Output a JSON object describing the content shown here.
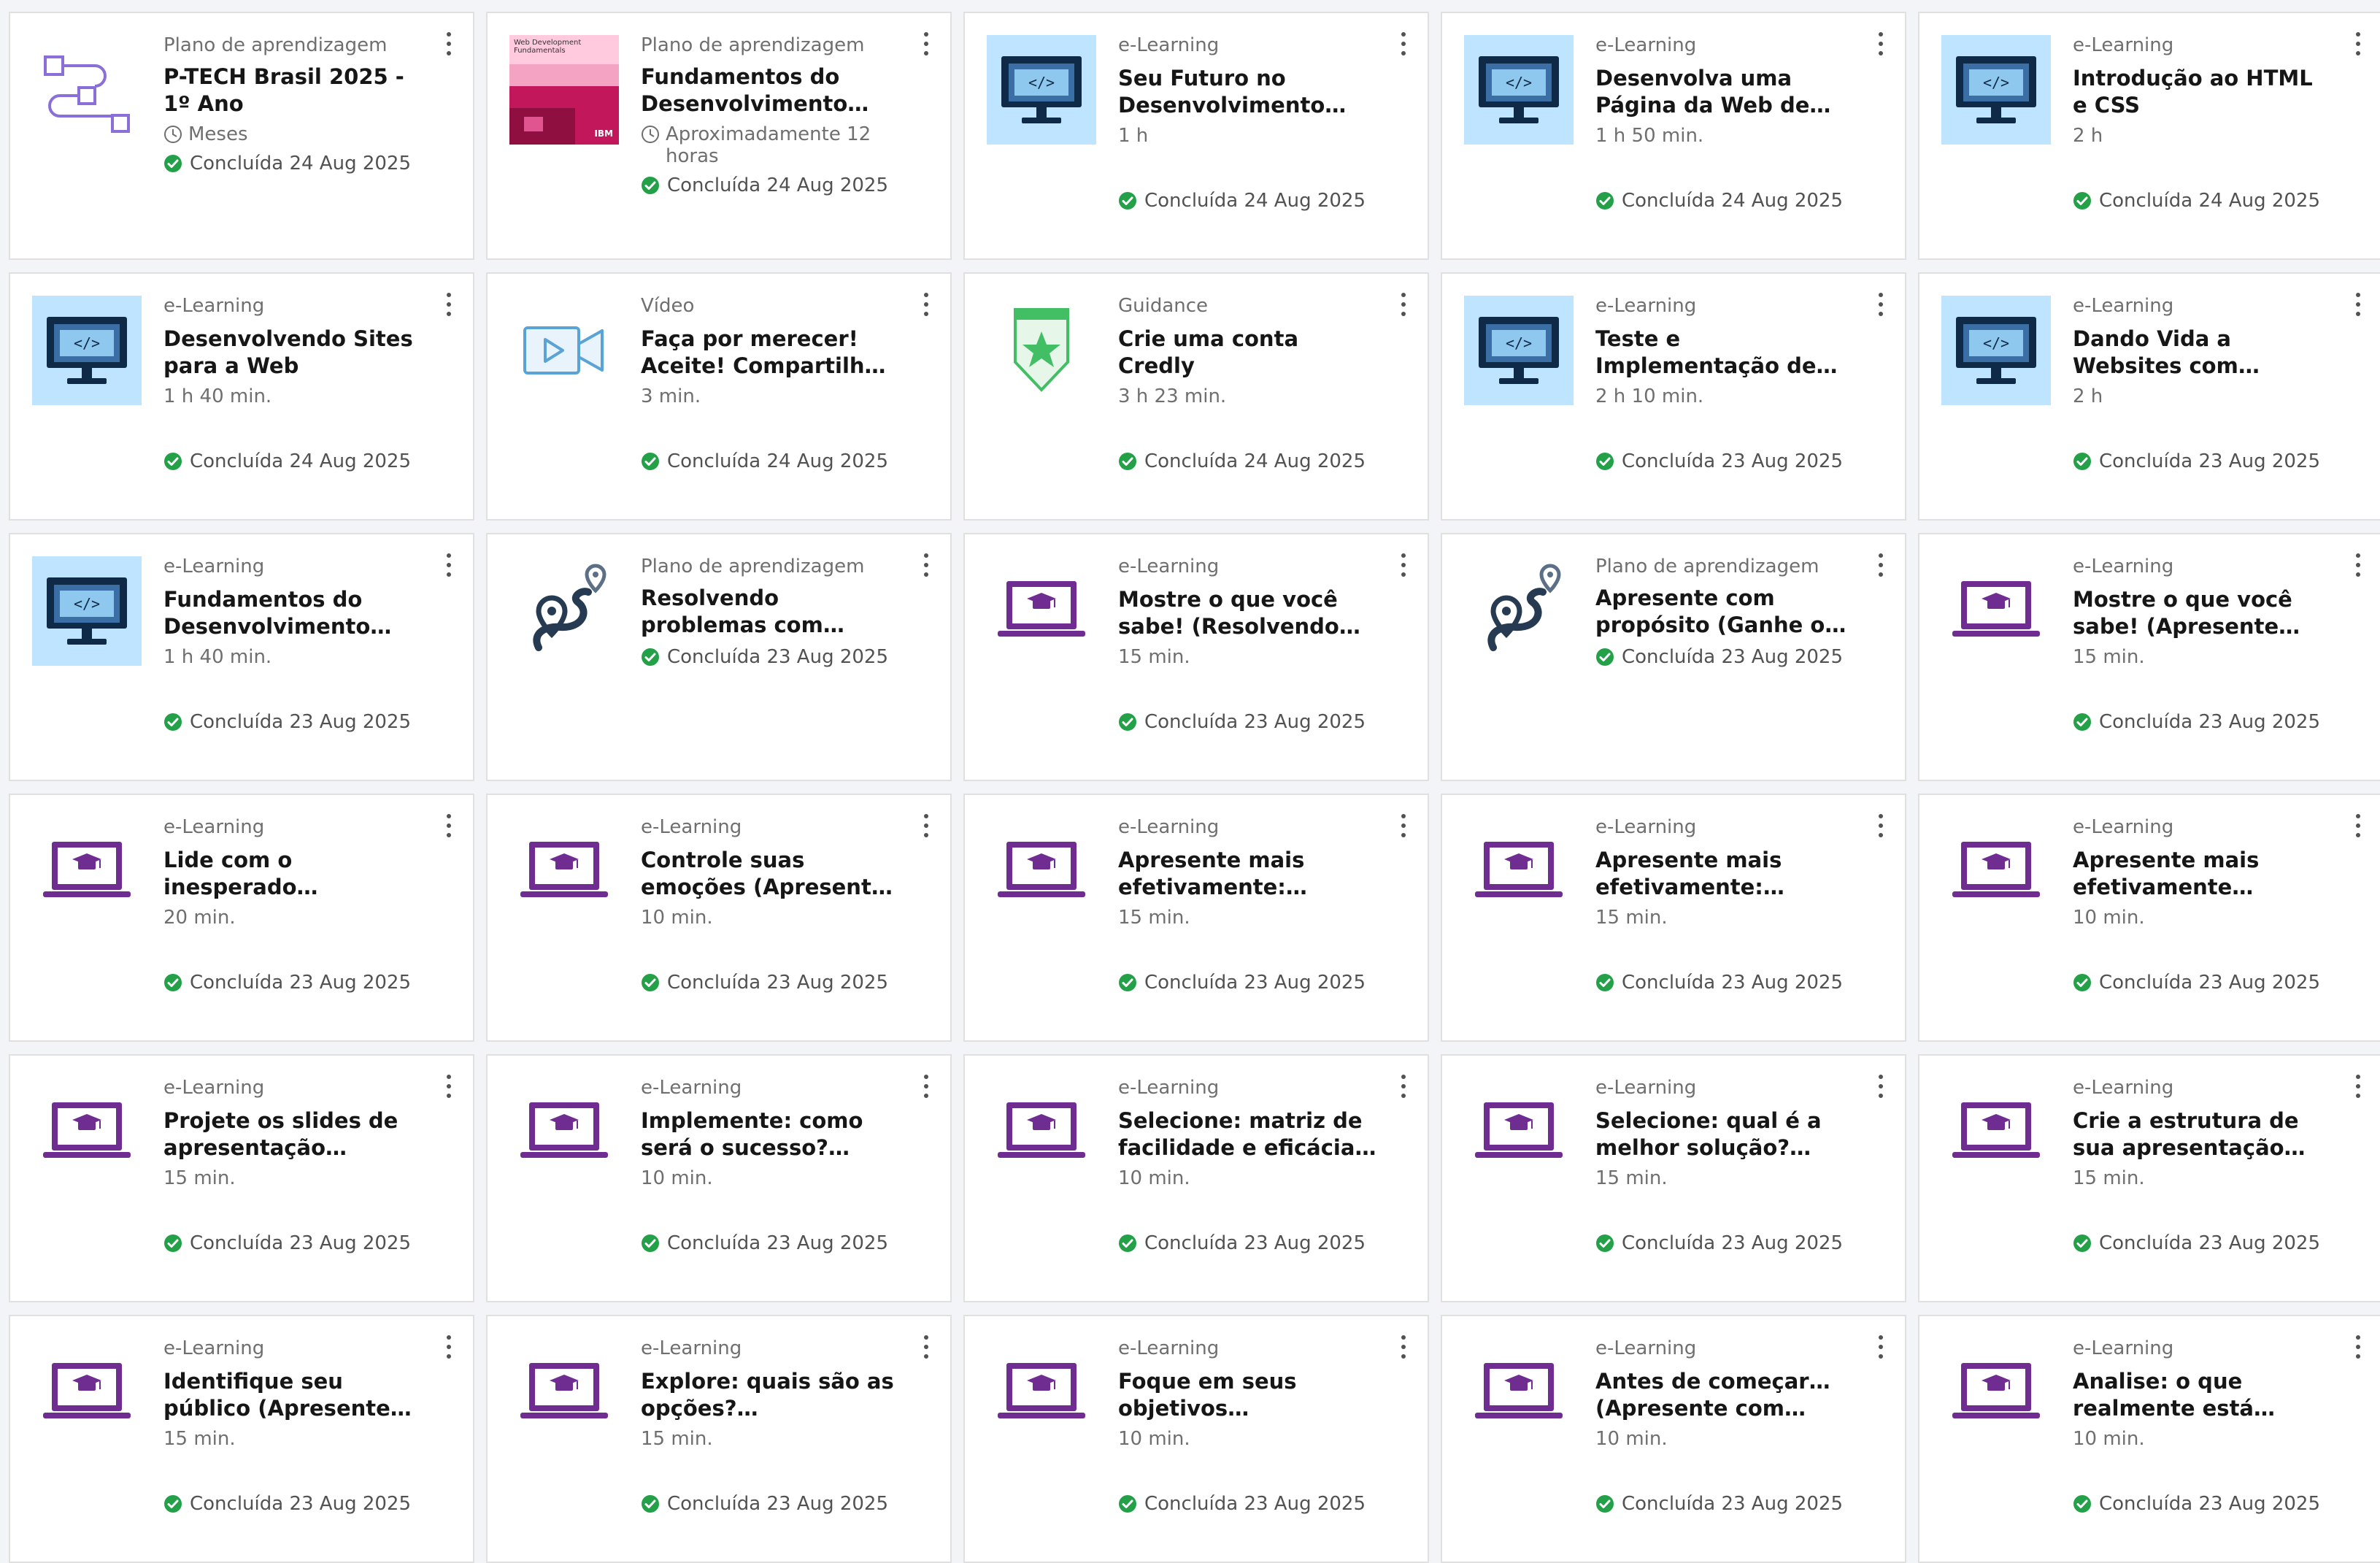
{
  "colors": {
    "accent_purple": "#6f2d91",
    "thumb_bg": "#bfe4ff",
    "monitor_dark": "#0e2a47",
    "success_green": "#24a148",
    "path_dark": "#263a52",
    "lavender": "#8a6fd8",
    "video_blue": "#5aa3d6",
    "badge_green": "#42be65"
  },
  "cards": [
    {
      "type": "Plano de aprendizagem",
      "title": "P-TECH Brasil 2025 - 1º Ano",
      "duration": "Meses",
      "status": "Concluída 24 Aug 2025",
      "icon": "learning-plan-icon",
      "clock": true
    },
    {
      "type": "Plano de aprendizagem",
      "title": "Fundamentos do Desenvolvimento Web…",
      "duration": "Aproximadamente 12 horas",
      "status": "Concluída 24 Aug 2025",
      "icon": "book-cover",
      "clock": true,
      "cover_title": "Web Development Fundamentals",
      "cover_brand": "IBM"
    },
    {
      "type": "e-Learning",
      "title": "Seu Futuro no Desenvolvimento Web…",
      "duration": "1 h",
      "status": "Concluída 24 Aug 2025",
      "icon": "monitor-code-icon"
    },
    {
      "type": "e-Learning",
      "title": "Desenvolva uma Página da Web de Lista de…",
      "duration": "1 h 50 min.",
      "status": "Concluída 24 Aug 2025",
      "icon": "monitor-code-icon"
    },
    {
      "type": "e-Learning",
      "title": "Introdução ao HTML e CSS",
      "duration": "2 h",
      "status": "Concluída 24 Aug 2025",
      "icon": "monitor-code-icon"
    },
    {
      "type": "e-Learning",
      "title": "Desenvolvendo Sites para a Web",
      "duration": "1 h 40 min.",
      "status": "Concluída 24 Aug 2025",
      "icon": "monitor-code-icon"
    },
    {
      "type": "Vídeo",
      "title": "Faça por merecer! Aceite! Compartilhe! |…",
      "duration": "3 min.",
      "status": "Concluída 24 Aug 2025",
      "icon": "video-icon"
    },
    {
      "type": "Guidance",
      "title": "Crie uma conta Credly",
      "duration": "3 h 23 min.",
      "status": "Concluída 24 Aug 2025",
      "icon": "badge-star-icon"
    },
    {
      "type": "e-Learning",
      "title": "Teste e Implementação de Website",
      "duration": "2 h 10 min.",
      "status": "Concluída 23 Aug 2025",
      "icon": "monitor-code-icon"
    },
    {
      "type": "e-Learning",
      "title": "Dando Vida a Websites com JavaScript",
      "duration": "2 h",
      "status": "Concluída 23 Aug 2025",
      "icon": "monitor-code-icon"
    },
    {
      "type": "e-Learning",
      "title": "Fundamentos do Desenvolvimento Web",
      "duration": "1 h 40 min.",
      "status": "Concluída 23 Aug 2025",
      "icon": "monitor-code-icon"
    },
    {
      "type": "Plano de aprendizagem",
      "title": "Resolvendo problemas com pensamento críti…",
      "duration": "",
      "status": "Concluída 23 Aug 2025",
      "icon": "map-path-icon"
    },
    {
      "type": "e-Learning",
      "title": "Mostre o que você sabe! (Resolvendo problem…",
      "duration": "15 min.",
      "status": "Concluída 23 Aug 2025",
      "icon": "laptop-graduation-icon"
    },
    {
      "type": "Plano de aprendizagem",
      "title": "Apresente com propósito (Ganhe o…",
      "duration": "",
      "status": "Concluída 23 Aug 2025",
      "icon": "map-path-icon"
    },
    {
      "type": "e-Learning",
      "title": "Mostre o que você sabe! (Apresente com…",
      "duration": "15 min.",
      "status": "Concluída 23 Aug 2025",
      "icon": "laptop-graduation-icon"
    },
    {
      "type": "e-Learning",
      "title": "Lide com o inesperado (Apresente com…",
      "duration": "20 min.",
      "status": "Concluída 23 Aug 2025",
      "icon": "laptop-graduation-icon"
    },
    {
      "type": "e-Learning",
      "title": "Controle suas emoções (Apresente com…",
      "duration": "10 min.",
      "status": "Concluída 23 Aug 2025",
      "icon": "laptop-graduation-icon"
    },
    {
      "type": "e-Learning",
      "title": "Apresente mais efetivamente: Técnica…",
      "duration": "15 min.",
      "status": "Concluída 23 Aug 2025",
      "icon": "laptop-graduation-icon"
    },
    {
      "type": "e-Learning",
      "title": "Apresente mais efetivamente: Técnica…",
      "duration": "15 min.",
      "status": "Concluída 23 Aug 2025",
      "icon": "laptop-graduation-icon"
    },
    {
      "type": "e-Learning",
      "title": "Apresente mais efetivamente…",
      "duration": "10 min.",
      "status": "Concluída 23 Aug 2025",
      "icon": "laptop-graduation-icon"
    },
    {
      "type": "e-Learning",
      "title": "Projete os slides de apresentação…",
      "duration": "15 min.",
      "status": "Concluída 23 Aug 2025",
      "icon": "laptop-graduation-icon"
    },
    {
      "type": "e-Learning",
      "title": "Implemente: como será o sucesso? (Resolven…",
      "duration": "10 min.",
      "status": "Concluída 23 Aug 2025",
      "icon": "laptop-graduation-icon"
    },
    {
      "type": "e-Learning",
      "title": "Selecione: matriz de facilidade e eficácia…",
      "duration": "10 min.",
      "status": "Concluída 23 Aug 2025",
      "icon": "laptop-graduation-icon"
    },
    {
      "type": "e-Learning",
      "title": "Selecione: qual é a melhor solução?…",
      "duration": "15 min.",
      "status": "Concluída 23 Aug 2025",
      "icon": "laptop-graduation-icon"
    },
    {
      "type": "e-Learning",
      "title": "Crie a estrutura de sua apresentação…",
      "duration": "15 min.",
      "status": "Concluída 23 Aug 2025",
      "icon": "laptop-graduation-icon"
    },
    {
      "type": "e-Learning",
      "title": "Identifique seu público (Apresente com…",
      "duration": "15 min.",
      "status": "Concluída 23 Aug 2025",
      "icon": "laptop-graduation-icon"
    },
    {
      "type": "e-Learning",
      "title": "Explore: quais são as opções? (Resolvendo…",
      "duration": "15 min.",
      "status": "Concluída 23 Aug 2025",
      "icon": "laptop-graduation-icon"
    },
    {
      "type": "e-Learning",
      "title": "Foque em seus objetivos (Apresente…",
      "duration": "10 min.",
      "status": "Concluída 23 Aug 2025",
      "icon": "laptop-graduation-icon"
    },
    {
      "type": "e-Learning",
      "title": "Antes de começar… (Apresente com…",
      "duration": "10 min.",
      "status": "Concluída 23 Aug 2025",
      "icon": "laptop-graduation-icon"
    },
    {
      "type": "e-Learning",
      "title": "Analise: o que realmente está…",
      "duration": "10 min.",
      "status": "Concluída 23 Aug 2025",
      "icon": "laptop-graduation-icon"
    }
  ]
}
